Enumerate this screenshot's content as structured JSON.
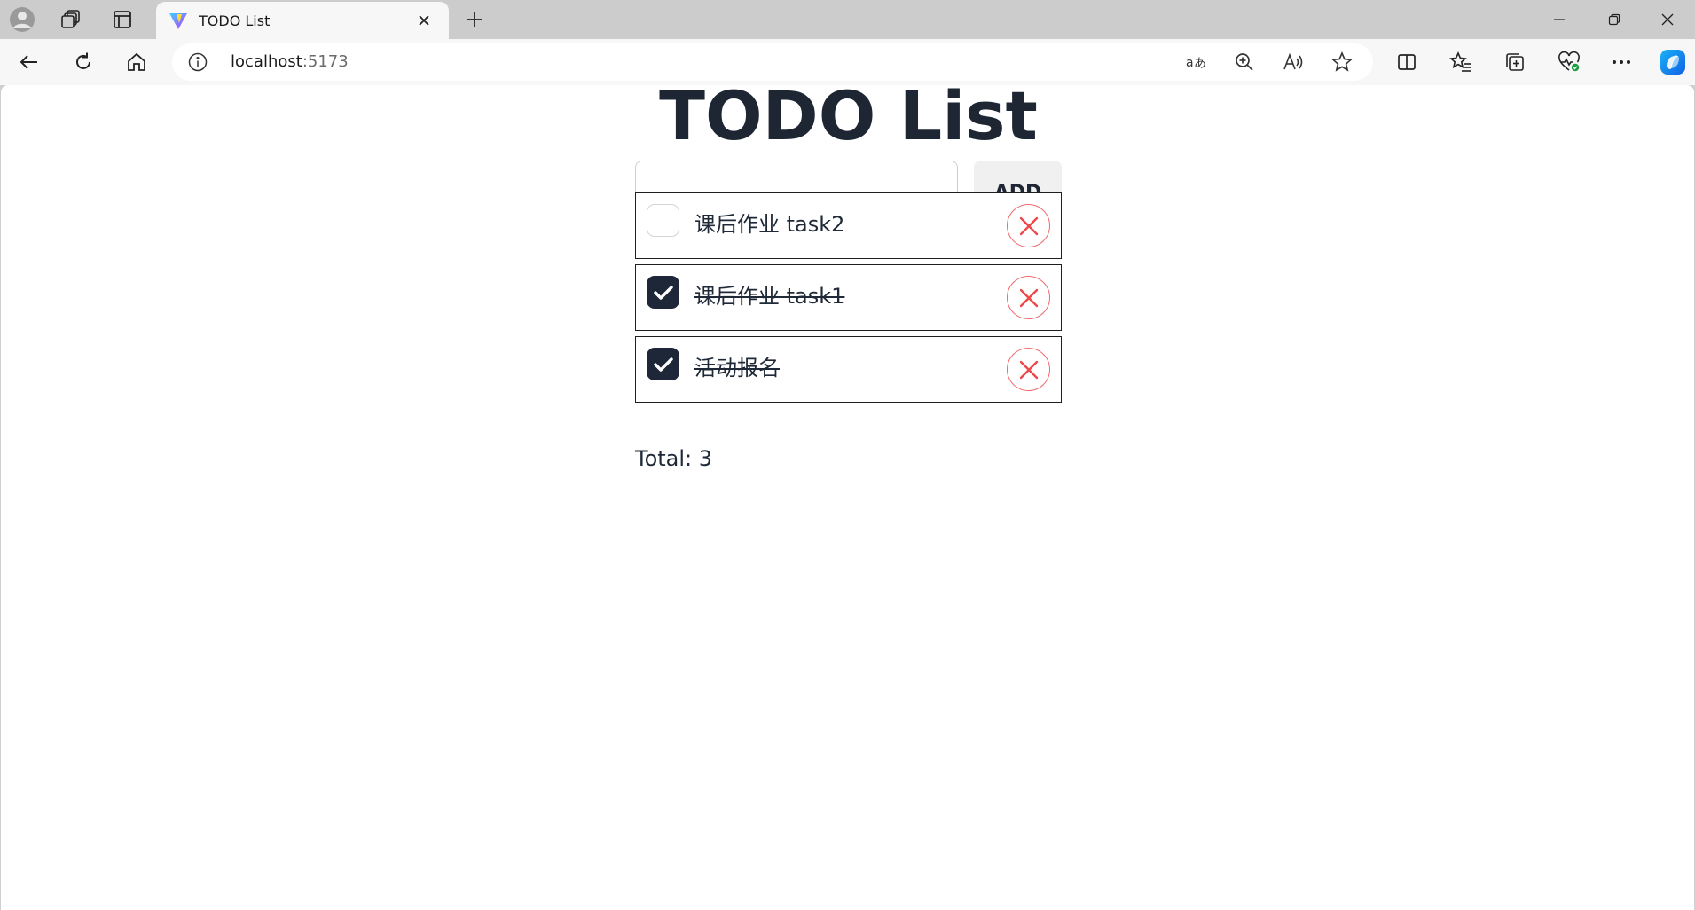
{
  "browser": {
    "tab_title": "TODO List",
    "url_host": "localhost",
    "url_port": ":5173"
  },
  "app": {
    "title": "TODO List",
    "input_value": "",
    "add_label": "ADD",
    "todos": [
      {
        "text": "课后作业 task2",
        "done": false
      },
      {
        "text": "课后作业 task1",
        "done": true
      },
      {
        "text": "活动报名",
        "done": true
      }
    ],
    "total_label": "Total: 3"
  },
  "colors": {
    "accent_dark": "#1e2738",
    "delete_red": "#f06a6a"
  }
}
